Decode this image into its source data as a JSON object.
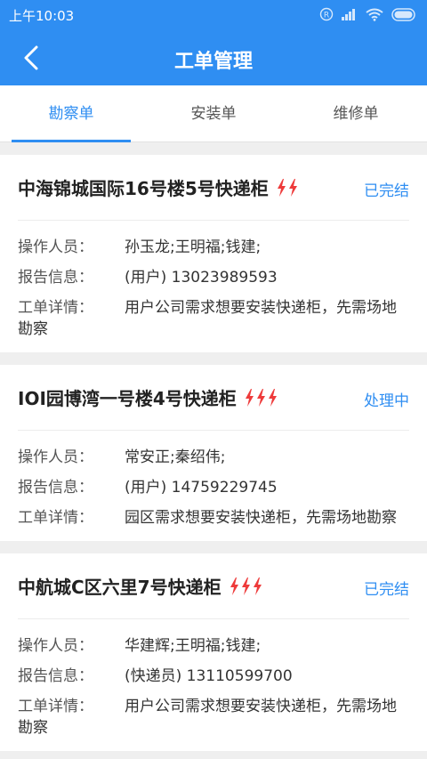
{
  "statusbar": {
    "time": "上午10:03"
  },
  "header": {
    "title": "工单管理"
  },
  "tabs": [
    {
      "label": "勘察单",
      "active": true
    },
    {
      "label": "安装单",
      "active": false
    },
    {
      "label": "维修单",
      "active": false
    }
  ],
  "labels": {
    "operators": "操作人员：",
    "report": "报告信息：",
    "detail": "工单详情："
  },
  "orders": [
    {
      "title": "中海锦城国际16号楼5号快递柜",
      "urgency": 2,
      "status": "已完结",
      "status_color": "#2f8ef2",
      "operators": "孙玉龙;王明福;钱建;",
      "report": "(用户)  13023989593",
      "detail": "用户公司需求想要安装快递柜，先需场地勘察"
    },
    {
      "title": "IOI园博湾一号楼4号快递柜",
      "urgency": 3,
      "status": "处理中",
      "status_color": "#2f8ef2",
      "operators": "常安正;秦绍伟;",
      "report": "(用户)  14759229745",
      "detail": "园区需求想要安装快递柜，先需场地勘察"
    },
    {
      "title": "中航城C区六里7号快递柜",
      "urgency": 3,
      "status": "已完结",
      "status_color": "#2f8ef2",
      "operators": "华建辉;王明福;钱建;",
      "report": "(快递员)  13110599700",
      "detail": "用户公司需求想要安装快递柜，先需场地勘察"
    }
  ],
  "colors": {
    "accent": "#2f8ef2",
    "urgent": "#ee3b3b"
  }
}
